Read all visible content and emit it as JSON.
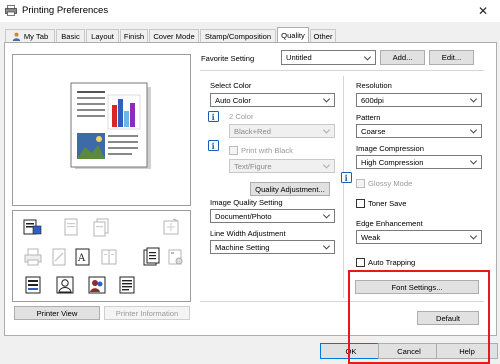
{
  "window": {
    "title": "Printing Preferences"
  },
  "tabs": [
    {
      "label": "My Tab",
      "active": false
    },
    {
      "label": "Basic",
      "active": false
    },
    {
      "label": "Layout",
      "active": false
    },
    {
      "label": "Finish",
      "active": false
    },
    {
      "label": "Cover Mode",
      "active": false
    },
    {
      "label": "Stamp/Composition",
      "active": false
    },
    {
      "label": "Quality",
      "active": true
    },
    {
      "label": "Other",
      "active": false
    }
  ],
  "favorite": {
    "label": "Favorite Setting",
    "value": "Untitled",
    "add_label": "Add...",
    "edit_label": "Edit..."
  },
  "left": {
    "printer_view_label": "Printer View",
    "printer_information_label": "Printer Information"
  },
  "middle": {
    "select_color_label": "Select Color",
    "select_color_value": "Auto Color",
    "two_color_label": "2 Color",
    "two_color_value": "Black+Red",
    "print_with_black_label": "Print with Black",
    "print_with_black_value": "Text/Figure",
    "quality_adjustment_label": "Quality Adjustment...",
    "image_quality_label": "Image Quality Setting",
    "image_quality_value": "Document/Photo",
    "line_width_label": "Line Width Adjustment",
    "line_width_value": "Machine Setting"
  },
  "right": {
    "resolution_label": "Resolution",
    "resolution_value": "600dpi",
    "pattern_label": "Pattern",
    "pattern_value": "Coarse",
    "image_compression_label": "Image Compression",
    "image_compression_value": "High Compression",
    "glossy_mode_label": "Glossy Mode",
    "toner_save_label": "Toner Save",
    "edge_enhancement_label": "Edge Enhancement",
    "edge_enhancement_value": "Weak",
    "auto_trapping_label": "Auto Trapping",
    "font_settings_label": "Font Settings...",
    "default_label": "Default"
  },
  "footer": {
    "ok_label": "OK",
    "cancel_label": "Cancel",
    "help_label": "Help"
  },
  "colors": {
    "highlight_box": "#e8191c",
    "button_face": "#e1e1e1",
    "info_icon": "#1a5fb4"
  },
  "icons": {
    "preview_icons": [
      "color-sheet-icon",
      "paper-icon",
      "paper-stack-icon",
      "fold-icon",
      "printer-icon",
      "watermark-icon",
      "text-doc-icon",
      "book-icon",
      "binder-icon",
      "person-icon",
      "person-group-icon",
      "document-icon"
    ]
  }
}
